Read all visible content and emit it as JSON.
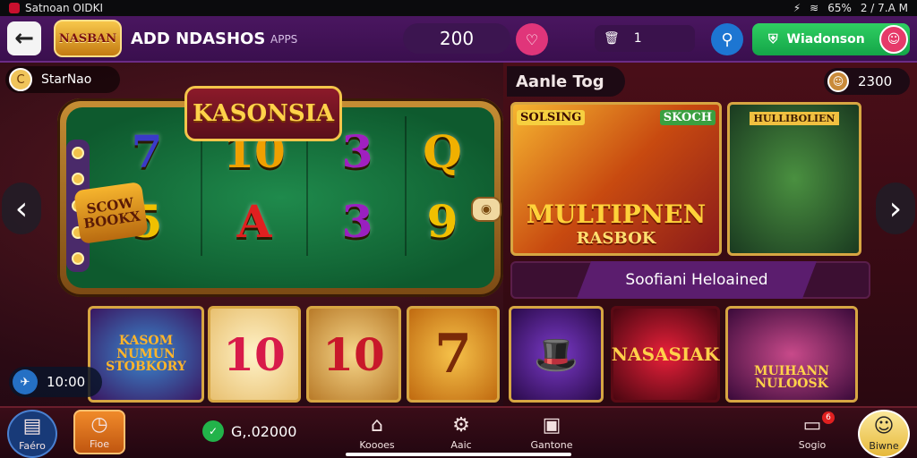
{
  "status_bar": {
    "left_text": "Satnoan  OIDKI",
    "right_battery": "65%",
    "right_time": "2 / 7.A M"
  },
  "header": {
    "back_icon": "arrow-left-icon",
    "logo_text": "NASBAN",
    "title": "ADD NDASHOS",
    "subtitle": "APPS",
    "balance": "200",
    "inbox_count": "1",
    "action_label": "Wiadonson"
  },
  "left": {
    "user_name": "StarNao",
    "slot_title": "KASONSIA",
    "slot_badge": "SCOW BOOKX",
    "reels": [
      [
        "7",
        "5"
      ],
      [
        "10",
        "A"
      ],
      [
        "3",
        "3"
      ],
      [
        "Q",
        "9"
      ]
    ],
    "reel_colors": [
      [
        "#3a3ac8",
        "#f0c000"
      ],
      [
        "#f0a000",
        "#e02020"
      ],
      [
        "#a020c0",
        "#9a20c0"
      ],
      [
        "#f0b000",
        "#f0c000"
      ]
    ],
    "tiles": [
      {
        "label": "KASOM NUMUN STOBKORY"
      },
      {
        "label": "10"
      },
      {
        "label": "10"
      },
      {
        "label": "7"
      }
    ],
    "balance": "10:00"
  },
  "right": {
    "section_title": "Aanle Tog",
    "coins": "2300",
    "games_top": [
      {
        "label": "SOLSING",
        "sub": "SKOCH",
        "title": "MULTIPNEN",
        "title2": "RASBOK"
      },
      {
        "label": "HULLIBOLIEN"
      }
    ],
    "banner": "Soofiani Heloained",
    "games_bottom": [
      {
        "label": ""
      },
      {
        "label": "NASASIAK"
      },
      {
        "label": "MUIHANN NULOOSK"
      }
    ]
  },
  "bottom_bar": {
    "home_label": "Faéro",
    "gift_label": "Fioe",
    "balance": "G,.02000",
    "bank_label": "Koooes",
    "settings_label": "Aaic",
    "center_label": "Gantone",
    "msg_label": "Sogio",
    "msg_badge": "6",
    "profile_label": "Biwne"
  }
}
